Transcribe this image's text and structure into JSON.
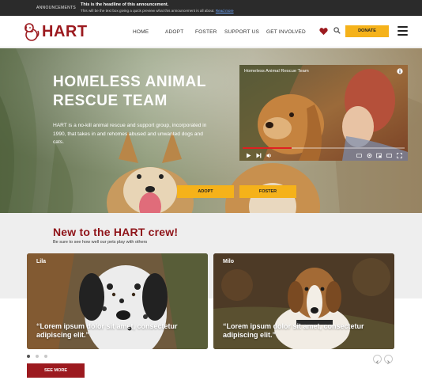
{
  "announcement": {
    "label": "ANNOUNCEMENTS",
    "headline": "This is the headline of this announcement.",
    "text": "This will be the text box giving a quick preview what this announcement is all about.",
    "link": "Read more"
  },
  "header": {
    "logo_text": "HART",
    "nav": [
      "HOME",
      "ADOPT",
      "FOSTER",
      "SUPPORT US",
      "GET INVOLVED"
    ],
    "donate": "DONATE"
  },
  "hero": {
    "title": "HOMELESS ANIMAL RESCUE TEAM",
    "text": "HART is a no-kill animal rescue and support group, incorporated in 1990, that takes in and rehomes abused and unwanted dogs and cats.",
    "adopt": "ADOPT",
    "foster": "FOSTER",
    "video": {
      "title": "Homeless Animal Rescue Team",
      "progress": 0.3
    }
  },
  "crew": {
    "title": "New to the HART crew!",
    "subtitle": "Be sure to see how well our pets play with others",
    "cards": [
      {
        "name": "Lila",
        "quote": "“Lorem ipsum dolor sit amet, consectetur adipiscing elit.”"
      },
      {
        "name": "Milo",
        "quote": "“Lorem ipsum dolor sit amet, consectetur adipiscing elit.”"
      }
    ],
    "see_more": "SEE MORE"
  },
  "colors": {
    "brand": "#9c1a1f",
    "accent": "#f5b21a",
    "announce_bg": "#2b2b2b"
  },
  "icons": [
    "logo-dog-icon",
    "heart-icon",
    "search-icon",
    "menu-icon",
    "info-icon",
    "play-icon",
    "next-icon",
    "volume-icon",
    "settings-icon",
    "fullscreen-icon",
    "chevron-left-icon",
    "chevron-right-icon"
  ]
}
